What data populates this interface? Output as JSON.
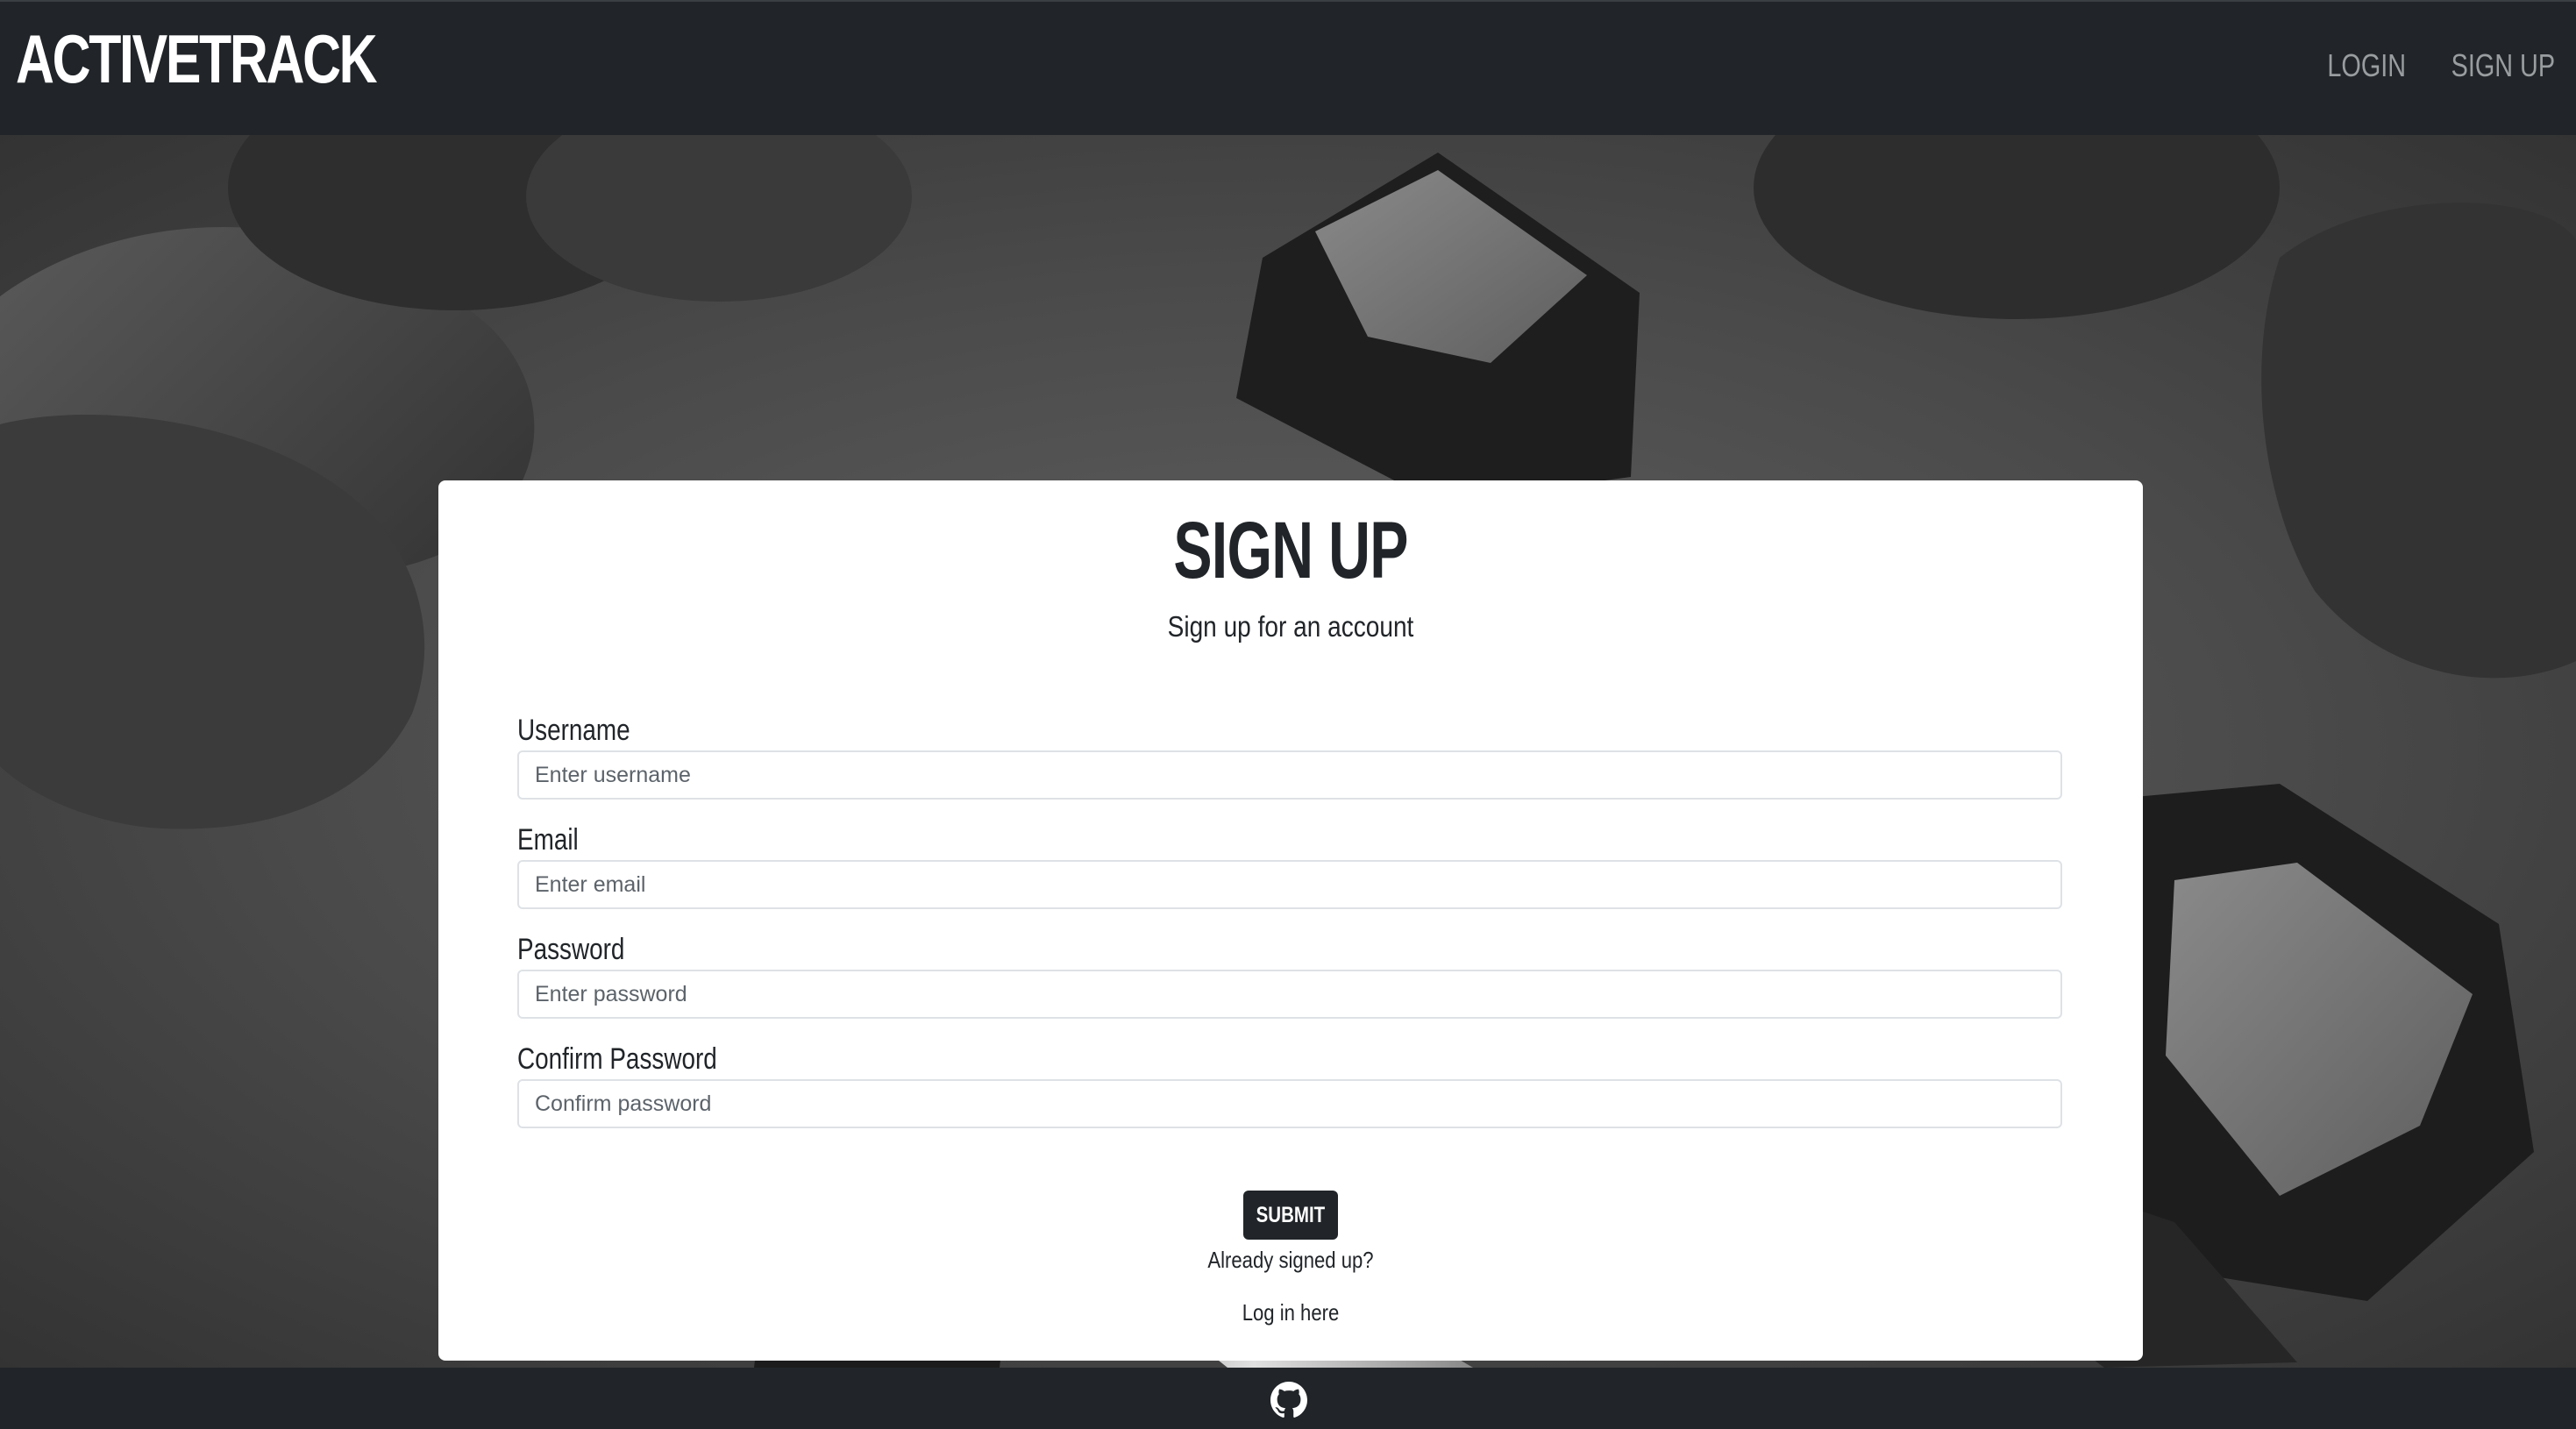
{
  "navbar": {
    "brand": "ACTIVETRACK",
    "links": [
      {
        "label": "LOGIN"
      },
      {
        "label": "SIGN UP"
      }
    ]
  },
  "form": {
    "title": "SIGN UP",
    "subtitle": "Sign up for an account",
    "fields": [
      {
        "label": "Username",
        "placeholder": "Enter username",
        "value": ""
      },
      {
        "label": "Email",
        "placeholder": "Enter email",
        "value": ""
      },
      {
        "label": "Password",
        "placeholder": "Enter password",
        "value": ""
      },
      {
        "label": "Confirm Password",
        "placeholder": "Confirm password",
        "value": ""
      }
    ],
    "submit_label": "SUBMIT",
    "already_text": "Already signed up?",
    "login_link": "Log in here"
  },
  "footer": {
    "icon": "github-icon"
  },
  "colors": {
    "navbar_bg": "#212529",
    "card_bg": "#ffffff",
    "button_bg": "#212529",
    "nav_link": "#9a9da0"
  }
}
